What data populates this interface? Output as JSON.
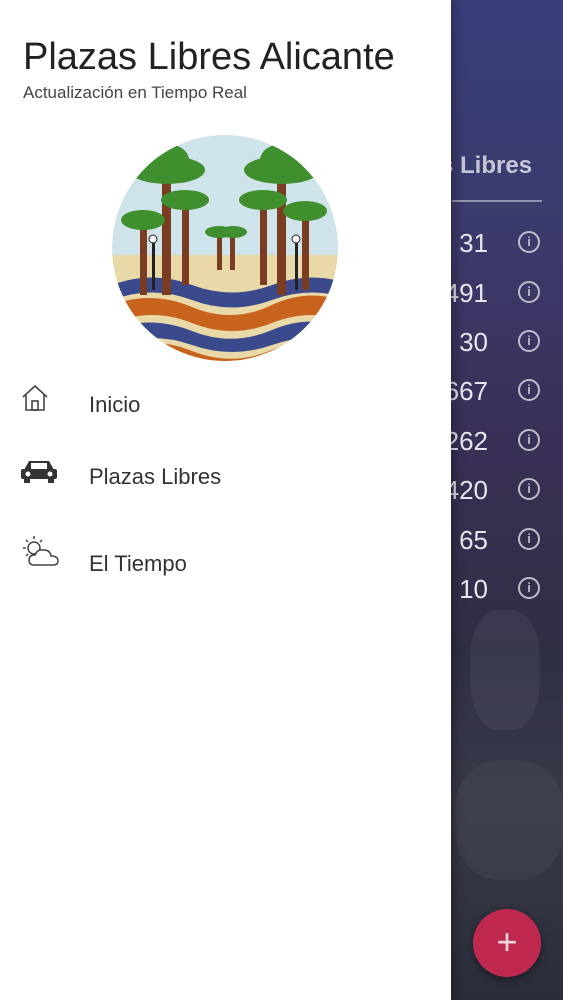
{
  "drawer": {
    "title": "Plazas Libres Alicante",
    "subtitle": "Actualización en Tiempo Real",
    "menu": [
      {
        "label": "Inicio",
        "icon": "home-icon"
      },
      {
        "label": "Plazas Libres",
        "icon": "car-icon"
      },
      {
        "label": "El Tiempo",
        "icon": "partly-cloudy-icon"
      }
    ]
  },
  "background": {
    "column_header": "s Libres",
    "rows": [
      {
        "value": "31"
      },
      {
        "value": "491"
      },
      {
        "value": "30"
      },
      {
        "value": "667"
      },
      {
        "value": "262"
      },
      {
        "value": "420"
      },
      {
        "value": "65"
      },
      {
        "value": "10"
      }
    ],
    "info_glyph": "i",
    "fab_glyph": "+"
  },
  "colors": {
    "accent": "#c0294f",
    "drawer_bg": "#ffffff",
    "background_gradient_top": "#3a3f7a"
  }
}
